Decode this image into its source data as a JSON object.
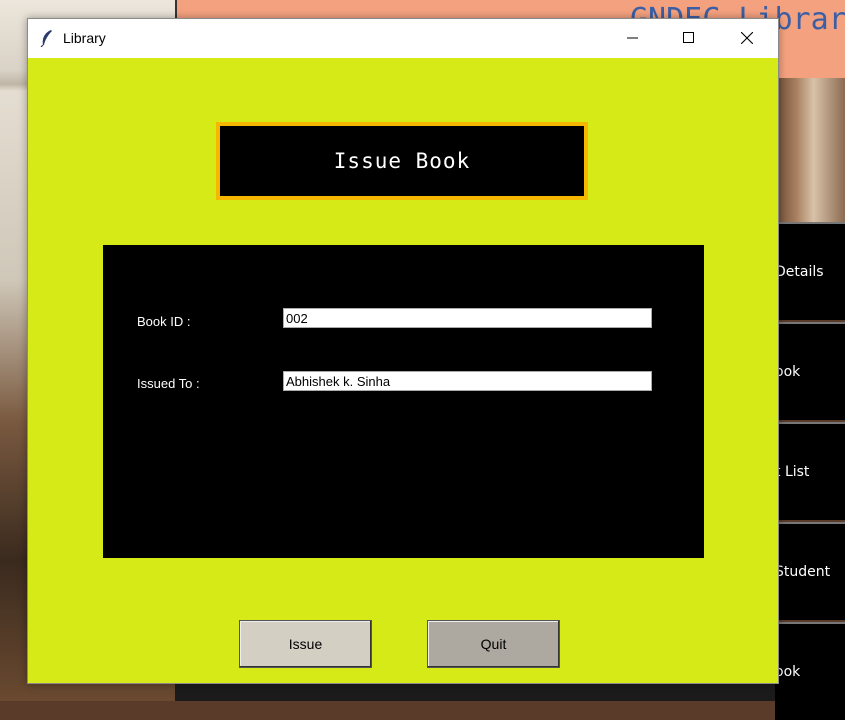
{
  "background_app": {
    "title": "GNDEC Library",
    "side_buttons": [
      "Details",
      "ook",
      "t List",
      "Student",
      "ook"
    ]
  },
  "window": {
    "title": "Library",
    "icons": {
      "app": "feather-icon",
      "minimize": "minimize-icon",
      "maximize": "maximize-icon",
      "close": "close-icon"
    }
  },
  "heading": "Issue Book",
  "form": {
    "book_id_label": "Book ID :",
    "book_id_value": "002",
    "issued_to_label": "Issued To :",
    "issued_to_value": "Abhishek k. Sinha"
  },
  "buttons": {
    "issue_label": "Issue",
    "quit_label": "Quit"
  },
  "colors": {
    "window_background": "#d6ea17",
    "heading_border": "#f5b700",
    "panel": "#000000",
    "issue_button": "#d3cfc3",
    "quit_button": "#ada9a0"
  }
}
